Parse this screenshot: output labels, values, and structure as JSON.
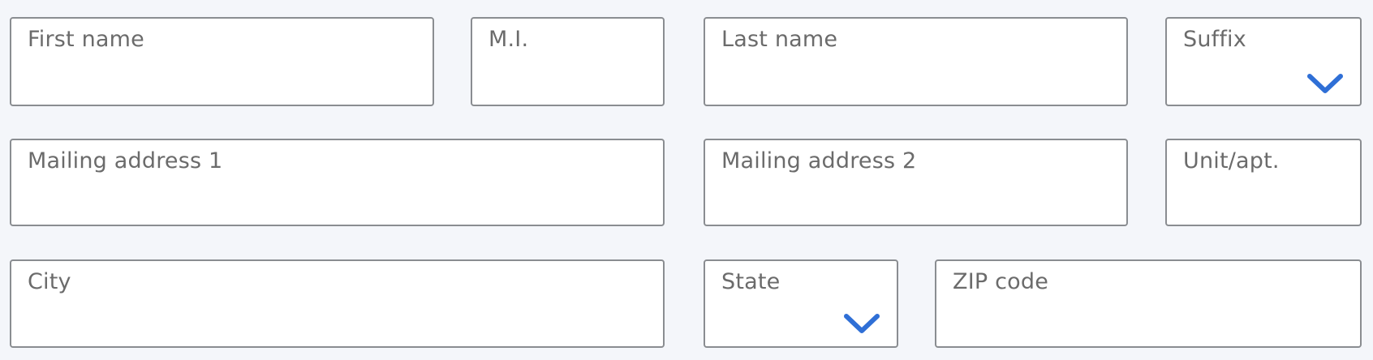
{
  "form": {
    "first_name": {
      "label": "First name",
      "value": ""
    },
    "middle_initial": {
      "label": "M.I.",
      "value": ""
    },
    "last_name": {
      "label": "Last name",
      "value": ""
    },
    "suffix": {
      "label": "Suffix",
      "selected": "",
      "icon": "chevron-down-icon"
    },
    "mailing_address_1": {
      "label": "Mailing address 1",
      "value": ""
    },
    "mailing_address_2": {
      "label": "Mailing address 2",
      "value": ""
    },
    "unit_apt": {
      "label": "Unit/apt.",
      "value": ""
    },
    "city": {
      "label": "City",
      "value": ""
    },
    "state": {
      "label": "State",
      "selected": "",
      "icon": "chevron-down-icon"
    },
    "zip_code": {
      "label": "ZIP code",
      "value": ""
    }
  },
  "colors": {
    "background": "#f4f6fa",
    "field_border": "#8a8d91",
    "label_text": "#6b6b6b",
    "chevron": "#2f6fd6"
  }
}
